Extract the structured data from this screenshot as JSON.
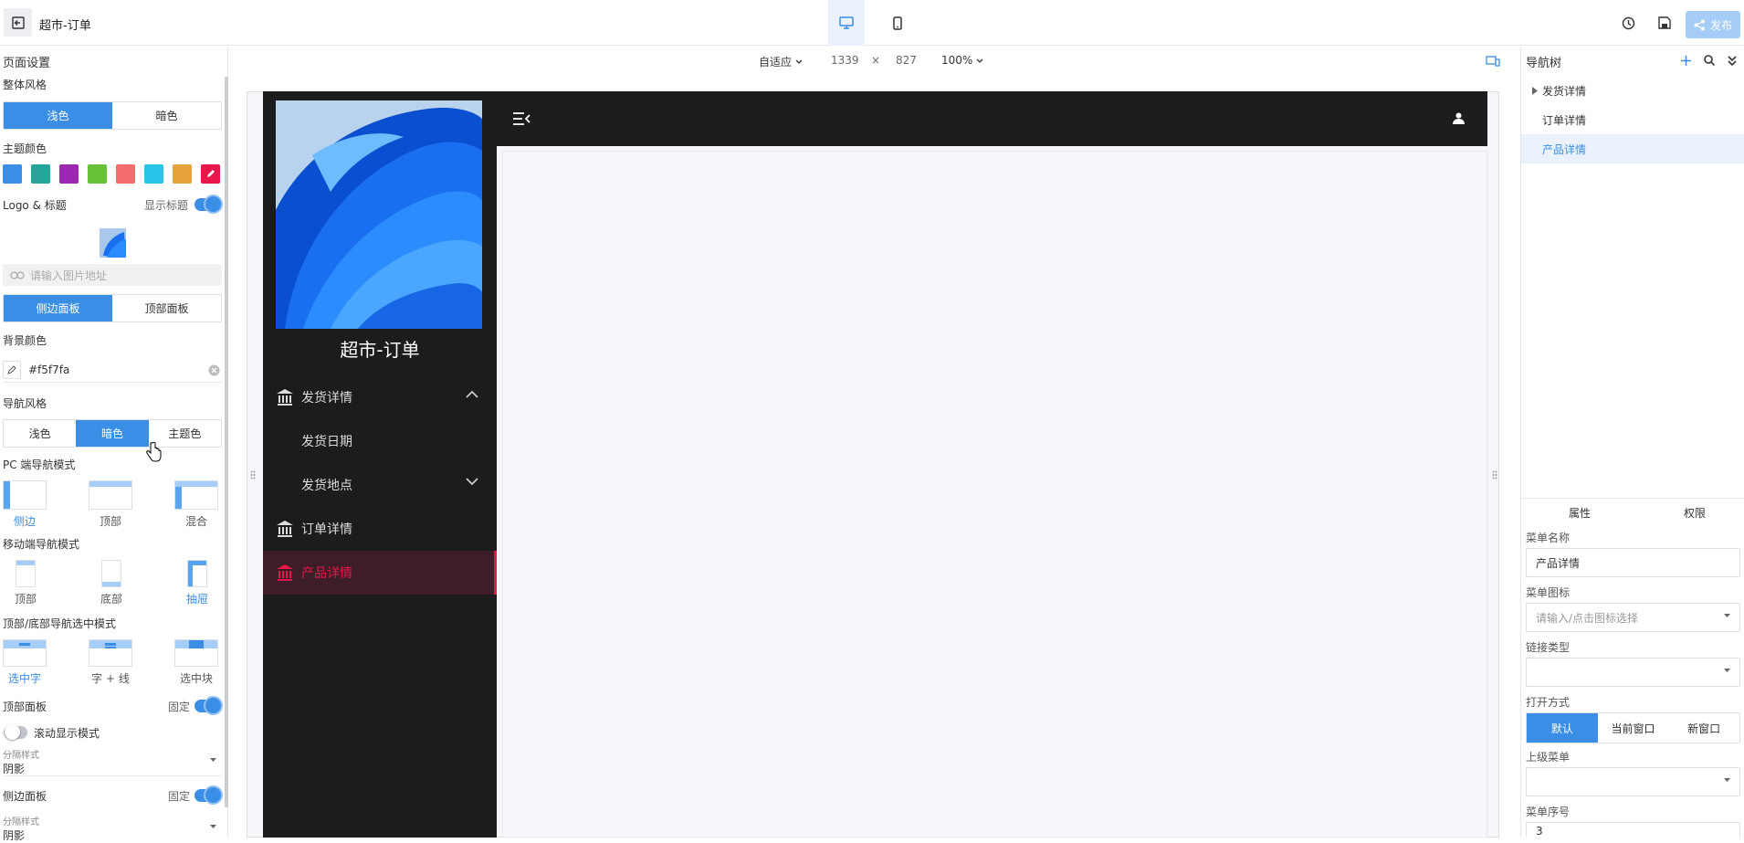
{
  "app": {
    "title": "超市-订单",
    "publish_label": "发布"
  },
  "canvas_header": {
    "fit_label": "自适应",
    "width": "1339",
    "times": "×",
    "height": "827",
    "zoom": "100%"
  },
  "left": {
    "section_title": "页面设置",
    "style_label": "整体风格",
    "style_options": [
      "浅色",
      "暗色"
    ],
    "theme_color_label": "主题颜色",
    "theme_colors": [
      "#3a8ee6",
      "#26a69a",
      "#9c27b0",
      "#67c23a",
      "#f56c6c",
      "#29c3e8",
      "#e6a23c",
      "#e8174b"
    ],
    "logo_label": "Logo & 标题",
    "show_title_label": "显示标题",
    "image_placeholder": "请输入图片地址",
    "panel_options": [
      "侧边面板",
      "顶部面板"
    ],
    "bg_color_label": "背景颜色",
    "bg_color_value": "#f5f7fa",
    "nav_style_label": "导航风格",
    "nav_style_options": [
      "浅色",
      "暗色",
      "主题色"
    ],
    "pc_nav_label": "PC 端导航模式",
    "pc_nav_options": [
      "侧边",
      "顶部",
      "混合"
    ],
    "mobile_nav_label": "移动端导航模式",
    "mobile_nav_options": [
      "顶部",
      "底部",
      "抽屉"
    ],
    "select_mode_label": "顶部/底部导航选中模式",
    "select_mode_options": [
      "选中字",
      "字 + 线",
      "选中块"
    ],
    "top_panel_label": "顶部面板",
    "fixed_label": "固定",
    "scroll_mode_label": "滚动显示模式",
    "divider_label": "分隔样式",
    "divider_value": "阴影",
    "side_panel_label": "侧边面板",
    "side_fixed_label": "固定",
    "side_divider_label": "分隔样式",
    "side_divider_value": "阴影"
  },
  "preview": {
    "site_title": "超市-订单",
    "nav": [
      {
        "label": "发货详情"
      },
      {
        "label": "发货日期"
      },
      {
        "label": "发货地点"
      },
      {
        "label": "订单详情"
      },
      {
        "label": "产品详情"
      }
    ]
  },
  "right": {
    "tree_title": "导航树",
    "tree": [
      "发货详情",
      "订单详情",
      "产品详情"
    ],
    "tabs": [
      "属性",
      "权限"
    ],
    "menu_name_label": "菜单名称",
    "menu_name_value": "产品详情",
    "menu_icon_label": "菜单图标",
    "menu_icon_placeholder": "请输入/点击图标选择",
    "link_type_label": "链接类型",
    "open_mode_label": "打开方式",
    "open_mode_options": [
      "默认",
      "当前窗口",
      "新窗口"
    ],
    "parent_menu_label": "上级菜单",
    "order_label": "菜单序号",
    "order_value": "3"
  }
}
